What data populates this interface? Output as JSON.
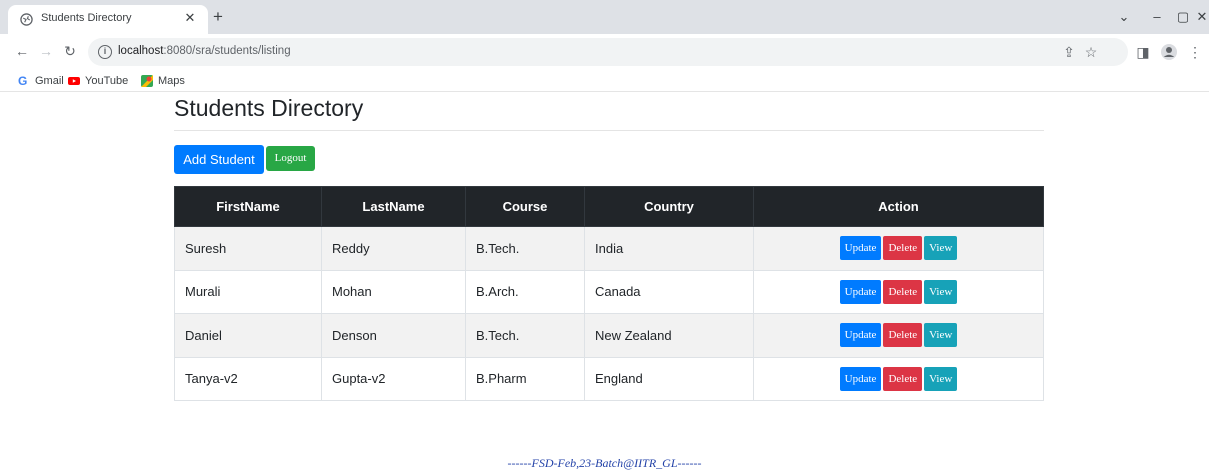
{
  "browser": {
    "tab_title": "Students Directory",
    "tab_close_icon": "close-icon",
    "new_tab_icon": "plus-icon",
    "window_controls": [
      "chevron-down-icon",
      "minimize-icon",
      "restore-icon",
      "close-icon"
    ],
    "url_host": "localhost",
    "url_path": ":8080/sra/students/listing",
    "bookmarks": [
      {
        "label": "Gmail",
        "icon": "google-icon"
      },
      {
        "label": "YouTube",
        "icon": "youtube-icon"
      },
      {
        "label": "Maps",
        "icon": "maps-icon"
      }
    ]
  },
  "page": {
    "title": "Students Directory",
    "add_button": "Add Student",
    "logout_button": "Logout",
    "table": {
      "headers": [
        "FirstName",
        "LastName",
        "Course",
        "Country",
        "Action"
      ],
      "rows": [
        {
          "first": "Suresh",
          "last": "Reddy",
          "course": "B.Tech.",
          "country": "India"
        },
        {
          "first": "Murali",
          "last": "Mohan",
          "course": "B.Arch.",
          "country": "Canada"
        },
        {
          "first": "Daniel",
          "last": "Denson",
          "course": "B.Tech.",
          "country": "New Zealand"
        },
        {
          "first": "Tanya-v2",
          "last": "Gupta-v2",
          "course": "B.Pharm",
          "country": "England"
        }
      ],
      "action_labels": {
        "update": "Update",
        "delete": "Delete",
        "view": "View"
      }
    },
    "footer": "------FSD-Feb,23-Batch@IITR_GL------"
  },
  "colors": {
    "primary": "#007bff",
    "success": "#28a745",
    "danger": "#dc3545",
    "info": "#17a2b8",
    "table_header": "#212529",
    "footer_text": "#2342a8"
  }
}
